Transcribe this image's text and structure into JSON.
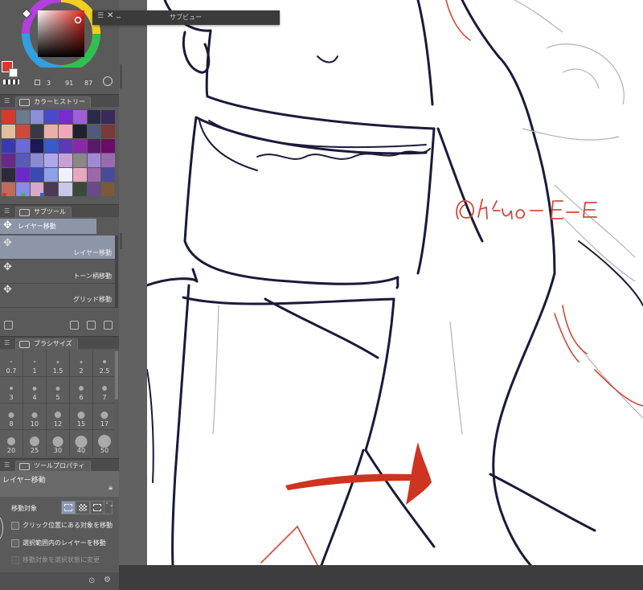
{
  "color": {
    "hsv_values": [
      "3",
      "91",
      "87"
    ],
    "foreground": "#d63a2b",
    "background": "#ffffff"
  },
  "sub_view": {
    "title": "サブビュー"
  },
  "color_history": {
    "tab_label": "カラーヒストリー",
    "swatches": [
      "#d63a2b",
      "#6c7a8e",
      "#8a8fd8",
      "#4a4ac8",
      "#7a2bd0",
      "#a05fd8",
      "#2a2a48",
      "#3a2a5a",
      "#e0bfa0",
      "#d0483c",
      "#383848",
      "#e8b0a8",
      "#f0a8b8",
      "#202030",
      "#505a78",
      "#7a3a3a",
      "#3a3ab0",
      "#6a6ad8",
      "#1a1a58",
      "#3a5ac8",
      "#5a3ab8",
      "#8a2aa8",
      "#5a1a6a",
      "#6a0a6a",
      "#6a2a8a",
      "#5a5ab8",
      "#8a8ad8",
      "#b0a8e8",
      "#c8a0d8",
      "#888888",
      "#a08ad8",
      "#9a6ab0",
      "#2a2a3a",
      "#6a2ac8",
      "#3a4ab0",
      "#8aa0e8",
      "#f0f0ff",
      "#e8a8c0",
      "#9a6aa8",
      "#4a4a9a",
      "#c06a5a",
      "#8a8ae8",
      "#d8a8c8",
      "#4a3a58",
      "#c8c8e8",
      "#3a4a3a",
      "#6a4a8a",
      "#7a5a3a"
    ]
  },
  "subtool": {
    "tab_label": "サブツール",
    "active_header": "レイヤー移動",
    "items": [
      "レイヤー移動",
      "トーン柄移動",
      "グリッド移動"
    ]
  },
  "brush_size": {
    "tab_label": "ブラシサイズ",
    "sizes": [
      "0.7",
      "1",
      "1.5",
      "2",
      "2.5",
      "3",
      "4",
      "5",
      "6",
      "7",
      "8",
      "10",
      "12",
      "15",
      "17",
      "20",
      "25",
      "30",
      "40",
      "50"
    ]
  },
  "tool_property": {
    "tab_label": "ツールプロパティ",
    "title": "レイヤー移動",
    "move_target_label": "移動対象",
    "spin_glyph": "⌃⌄",
    "checkboxes": [
      "クリック位置にある対象を移動",
      "選択範囲内のレイヤーを移動",
      "移動対象を選択状態に変更"
    ]
  },
  "canvas": {
    "watermark": "@hatuo-E",
    "arrow_color": "#cf3321"
  }
}
